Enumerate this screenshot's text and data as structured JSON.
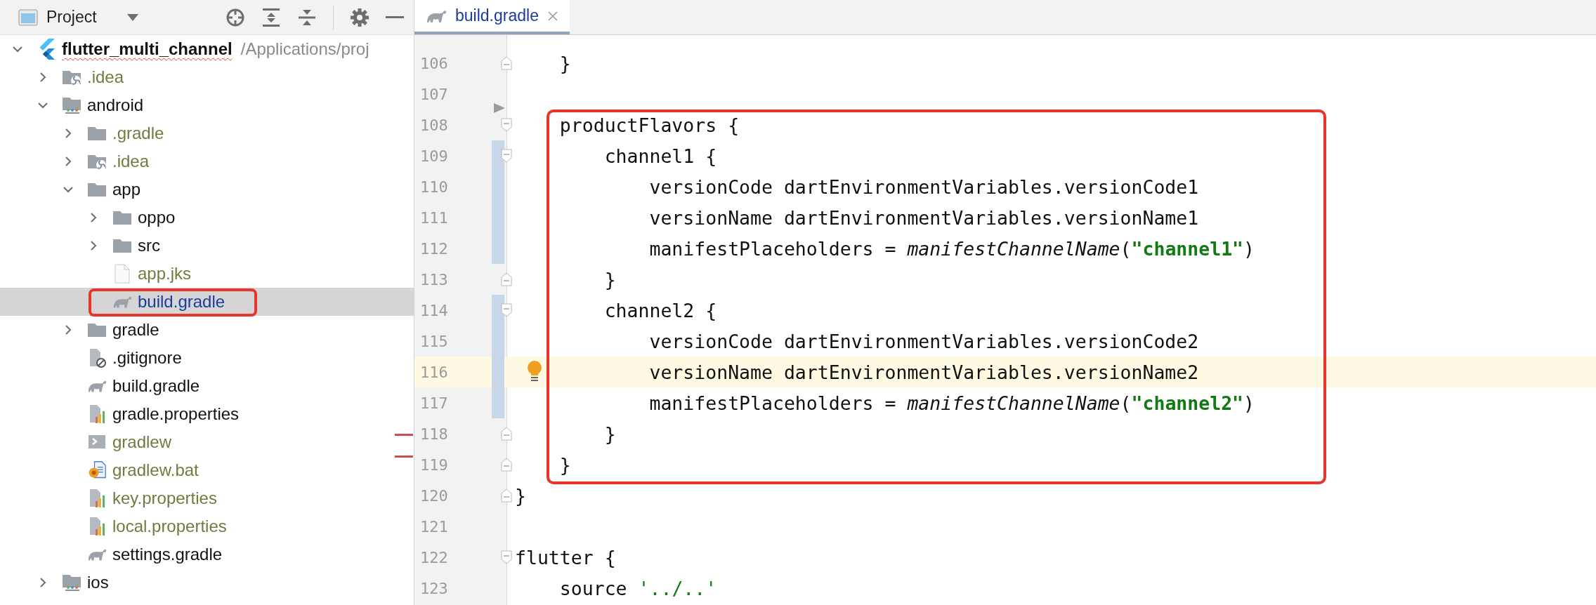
{
  "project_panel": {
    "title": "Project",
    "tree": [
      {
        "name": "flutter_multi_channel",
        "path": "/Applications/proj",
        "kind": "flutter",
        "spelling_error": true,
        "expanded": true,
        "selected": false,
        "children": [
          {
            "name": ".idea",
            "kind": "idea-folder",
            "expanded": false,
            "selected": false,
            "ignored": true
          },
          {
            "name": "android",
            "kind": "module-folder",
            "expanded": true,
            "selected": false,
            "children": [
              {
                "name": ".gradle",
                "kind": "folder",
                "expanded": false,
                "selected": false,
                "ignored": true
              },
              {
                "name": ".idea",
                "kind": "idea-folder",
                "expanded": false,
                "selected": false,
                "ignored": true
              },
              {
                "name": "app",
                "kind": "folder",
                "expanded": true,
                "selected": false,
                "children": [
                  {
                    "name": "oppo",
                    "kind": "folder",
                    "expanded": false,
                    "selected": false
                  },
                  {
                    "name": "src",
                    "kind": "folder",
                    "expanded": false,
                    "selected": false
                  },
                  {
                    "name": "app.jks",
                    "kind": "file",
                    "selected": false,
                    "ignored": true
                  },
                  {
                    "name": "build.gradle",
                    "kind": "gradle",
                    "selected": true,
                    "boxed": true,
                    "modified": true
                  }
                ]
              },
              {
                "name": "gradle",
                "kind": "folder",
                "expanded": false,
                "selected": false
              },
              {
                "name": ".gitignore",
                "kind": "gitignore",
                "selected": false
              },
              {
                "name": "build.gradle",
                "kind": "gradle",
                "selected": false
              },
              {
                "name": "gradle.properties",
                "kind": "properties",
                "selected": false
              },
              {
                "name": "gradlew",
                "kind": "shell",
                "selected": false,
                "ignored": true
              },
              {
                "name": "gradlew.bat",
                "kind": "bat",
                "selected": false,
                "ignored": true
              },
              {
                "name": "key.properties",
                "kind": "properties",
                "selected": false,
                "ignored": true
              },
              {
                "name": "local.properties",
                "kind": "properties",
                "selected": false,
                "ignored": true
              },
              {
                "name": "settings.gradle",
                "kind": "gradle",
                "selected": false
              }
            ]
          },
          {
            "name": "ios",
            "kind": "module-folder",
            "expanded": false,
            "selected": false
          }
        ]
      }
    ]
  },
  "editor": {
    "tabs": [
      {
        "label": "build.gradle",
        "selected": true,
        "modified": true
      }
    ],
    "lines": [
      {
        "number": "106",
        "fold_end": true,
        "tokens": [
          {
            "kind": "plain",
            "text": "    }"
          }
        ]
      },
      {
        "number": "107"
      },
      {
        "number": "108",
        "fold_start": true,
        "marker": true,
        "boxed": true,
        "tokens": [
          {
            "kind": "plain",
            "text": "    productFlavors {"
          }
        ]
      },
      {
        "number": "109",
        "fold_start": true,
        "changed": true,
        "boxed": true,
        "tokens": [
          {
            "kind": "plain",
            "text": "        channel1 {"
          }
        ]
      },
      {
        "number": "110",
        "changed": true,
        "boxed": true,
        "tokens": [
          {
            "kind": "plain",
            "text": "            versionCode dartEnvironmentVariables.versionCode1"
          }
        ]
      },
      {
        "number": "111",
        "changed": true,
        "boxed": true,
        "tokens": [
          {
            "kind": "plain",
            "text": "            versionName dartEnvironmentVariables.versionName1"
          }
        ]
      },
      {
        "number": "112",
        "changed": true,
        "boxed": true,
        "tokens": [
          {
            "kind": "plain",
            "text": "            manifestPlaceholders = "
          },
          {
            "kind": "function",
            "text": "manifestChannelName"
          },
          {
            "kind": "plain",
            "text": "("
          },
          {
            "kind": "string",
            "text": "\"channel1\""
          },
          {
            "kind": "plain",
            "text": ")"
          }
        ]
      },
      {
        "number": "113",
        "fold_end": true,
        "boxed": true,
        "tokens": [
          {
            "kind": "plain",
            "text": "        }"
          }
        ]
      },
      {
        "number": "114",
        "fold_start": true,
        "changed": true,
        "boxed": true,
        "tokens": [
          {
            "kind": "plain",
            "text": "        channel2 {"
          }
        ]
      },
      {
        "number": "115",
        "changed": true,
        "boxed": true,
        "tokens": [
          {
            "kind": "plain",
            "text": "            versionCode dartEnvironmentVariables.versionCode2"
          }
        ]
      },
      {
        "number": "116",
        "bulb": true,
        "changed": true,
        "current": true,
        "boxed": true,
        "tokens": [
          {
            "kind": "plain",
            "text": "            versionName dartEnvironmentVariables.versionName2"
          }
        ]
      },
      {
        "number": "117",
        "changed": true,
        "boxed": true,
        "tokens": [
          {
            "kind": "plain",
            "text": "            manifestPlaceholders = "
          },
          {
            "kind": "function",
            "text": "manifestChannelName"
          },
          {
            "kind": "plain",
            "text": "("
          },
          {
            "kind": "string",
            "text": "\"channel2\""
          },
          {
            "kind": "plain",
            "text": ")"
          }
        ]
      },
      {
        "number": "118",
        "fold_end": true,
        "boxed": true,
        "tokens": [
          {
            "kind": "plain",
            "text": "        }"
          }
        ]
      },
      {
        "number": "119",
        "fold_end": true,
        "boxed": true,
        "tokens": [
          {
            "kind": "plain",
            "text": "    }"
          }
        ]
      },
      {
        "number": "120",
        "fold_end": true,
        "tokens": [
          {
            "kind": "plain",
            "text": "}"
          }
        ]
      },
      {
        "number": "121"
      },
      {
        "number": "122",
        "fold_start": true,
        "tokens": [
          {
            "kind": "plain",
            "text": "flutter {"
          }
        ]
      },
      {
        "number": "123",
        "tokens": [
          {
            "kind": "plain",
            "text": "    source "
          },
          {
            "kind": "string-plain",
            "text": "'../..'"
          }
        ]
      }
    ]
  }
}
